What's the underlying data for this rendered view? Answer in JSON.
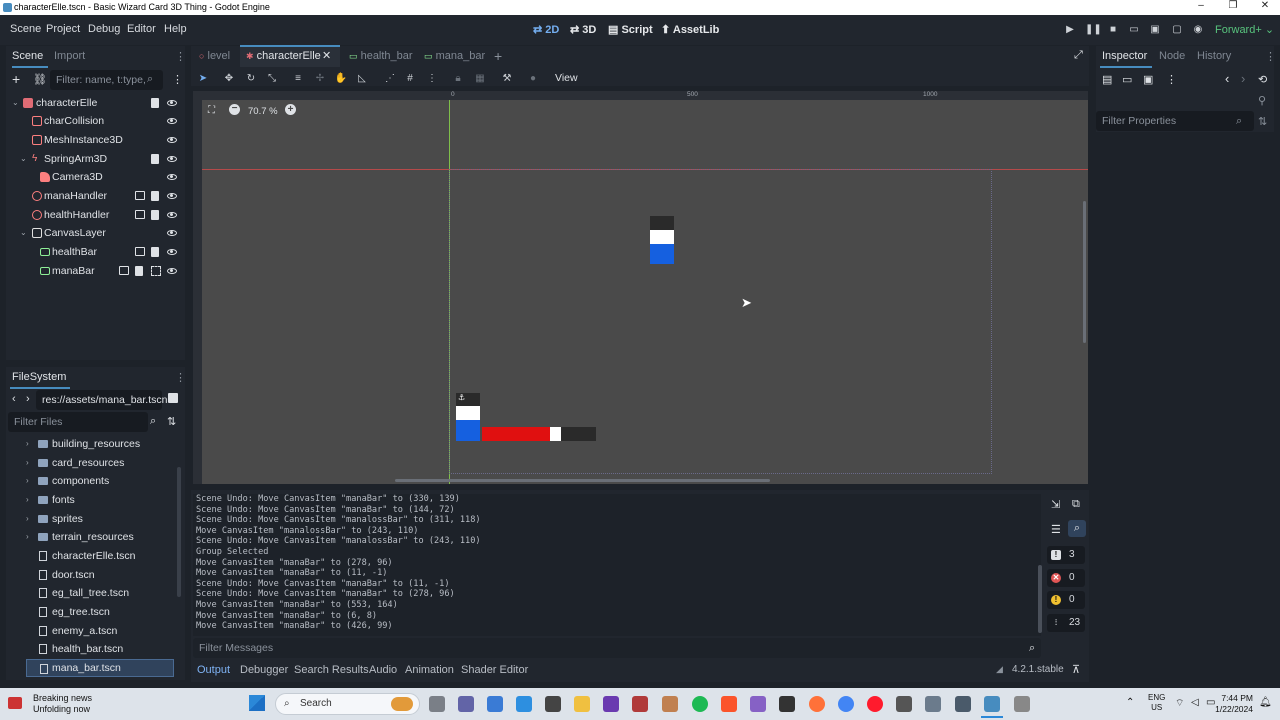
{
  "window": {
    "title": "characterElle.tscn - Basic Wizard Card 3D Thing - Godot Engine",
    "controls": [
      "–",
      "❐",
      "✕"
    ]
  },
  "menubar": {
    "menus": [
      "Scene",
      "Project",
      "Debug",
      "Editor",
      "Help"
    ],
    "workspaces": [
      {
        "label": "2D",
        "active": true
      },
      {
        "label": "3D",
        "active": false
      },
      {
        "label": "Script",
        "active": false
      },
      {
        "label": "AssetLib",
        "active": false
      }
    ],
    "renderer": "Forward+"
  },
  "scene_dock": {
    "tabs": [
      "Scene",
      "Import"
    ],
    "filter_placeholder": "Filter: name, t:type,",
    "nodes": [
      {
        "label": "characterElle",
        "icon_color": "#e06c75",
        "icon": "node3d-icon"
      },
      {
        "label": "charCollision",
        "icon_color": "#fc7f7f",
        "icon": "collision-icon"
      },
      {
        "label": "MeshInstance3D",
        "icon_color": "#fc7f7f",
        "icon": "mesh-icon"
      },
      {
        "label": "SpringArm3D",
        "icon_color": "#fc7f7f",
        "icon": "springarm-icon"
      },
      {
        "label": "Camera3D",
        "icon_color": "#fc7f7f",
        "icon": "camera-icon"
      },
      {
        "label": "manaHandler",
        "icon_color": "#fc7f7f",
        "icon": "node-icon"
      },
      {
        "label": "healthHandler",
        "icon_color": "#fc7f7f",
        "icon": "node-icon"
      },
      {
        "label": "CanvasLayer",
        "icon_color": "#e0e0e0",
        "icon": "canvaslayer-icon"
      },
      {
        "label": "healthBar",
        "icon_color": "#8eef97",
        "icon": "control-icon"
      },
      {
        "label": "manaBar",
        "icon_color": "#8eef97",
        "icon": "control-icon"
      }
    ]
  },
  "filesystem": {
    "title": "FileSystem",
    "path": "res://assets/mana_bar.tscn",
    "filter_placeholder": "Filter Files",
    "items": [
      {
        "label": "building_resources",
        "type": "folder"
      },
      {
        "label": "card_resources",
        "type": "folder"
      },
      {
        "label": "components",
        "type": "folder"
      },
      {
        "label": "fonts",
        "type": "folder"
      },
      {
        "label": "sprites",
        "type": "folder"
      },
      {
        "label": "terrain_resources",
        "type": "folder"
      },
      {
        "label": "characterElle.tscn",
        "type": "file"
      },
      {
        "label": "door.tscn",
        "type": "file"
      },
      {
        "label": "eg_tall_tree.tscn",
        "type": "file"
      },
      {
        "label": "eg_tree.tscn",
        "type": "file"
      },
      {
        "label": "enemy_a.tscn",
        "type": "file"
      },
      {
        "label": "health_bar.tscn",
        "type": "file"
      },
      {
        "label": "mana_bar.tscn",
        "type": "file",
        "selected": true
      }
    ]
  },
  "editor_tabs": [
    {
      "label": "level",
      "active": false
    },
    {
      "label": "characterElle",
      "active": true
    },
    {
      "label": "health_bar",
      "active": false
    },
    {
      "label": "mana_bar",
      "active": false
    }
  ],
  "toolbar": {
    "view_label": "View"
  },
  "viewport": {
    "zoom": "70.7 %",
    "ruler_marks": [
      "0",
      "500",
      "1000"
    ]
  },
  "output_log": [
    "Scene Undo: Move CanvasItem \"manaBar\" to (330, 139)",
    "Scene Undo: Move CanvasItem \"manaBar\" to (144, 72)",
    "Scene Undo: Move CanvasItem \"manalossBar\" to (311, 118)",
    "Move CanvasItem \"manalossBar\" to (243, 110)",
    "Scene Undo: Move CanvasItem \"manalossBar\" to (243, 110)",
    "Group Selected",
    "Move CanvasItem \"manaBar\" to (278, 96)",
    "Move CanvasItem \"manaBar\" to (11, -1)",
    "Scene Undo: Move CanvasItem \"manaBar\" to (11, -1)",
    "Scene Undo: Move CanvasItem \"manaBar\" to (278, 96)",
    "Move CanvasItem \"manaBar\" to (553, 164)",
    "Move CanvasItem \"manaBar\" to (6, 8)",
    "Move CanvasItem \"manaBar\" to (426, 99)"
  ],
  "output_filter_placeholder": "Filter Messages",
  "output_counters": {
    "messages": "3",
    "errors": "0",
    "warnings": "0",
    "editor": "23"
  },
  "bottom_tabs": [
    "Output",
    "Debugger",
    "Search Results",
    "Audio",
    "Animation",
    "Shader Editor"
  ],
  "version": "4.2.1.stable",
  "inspector": {
    "tabs": [
      "Inspector",
      "Node",
      "History"
    ],
    "filter_placeholder": "Filter Properties"
  },
  "taskbar": {
    "news_title": "Breaking news",
    "news_sub": "Unfolding now",
    "search_placeholder": "Search",
    "lang_top": "ENG",
    "lang_bottom": "US",
    "time": "7:44 PM",
    "date": "1/22/2024"
  }
}
